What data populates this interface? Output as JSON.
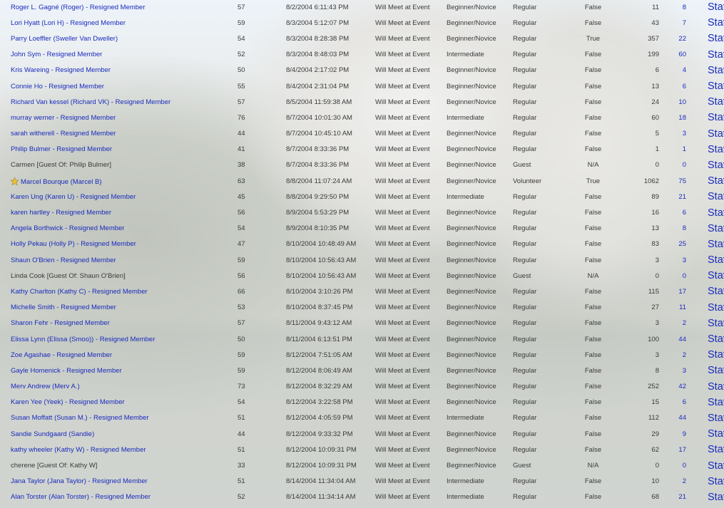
{
  "rows": [
    {
      "name": "Roger L. Gagné (Roger) - Resigned Member",
      "link": true,
      "star": false,
      "age": "57",
      "date": "8/2/2004 6:11:43 PM",
      "meet": "Will Meet at Event",
      "level": "Beginner/Novice",
      "role": "Regular",
      "flag": "False",
      "n1": "11",
      "n2": "8",
      "stats": "Stats"
    },
    {
      "name": "Lori Hyatt (Lori H) - Resigned Member",
      "link": true,
      "star": false,
      "age": "59",
      "date": "8/3/2004 5:12:07 PM",
      "meet": "Will Meet at Event",
      "level": "Beginner/Novice",
      "role": "Regular",
      "flag": "False",
      "n1": "43",
      "n2": "7",
      "stats": "Stats"
    },
    {
      "name": "Parry Loeffler (Sweller Van Dweller)",
      "link": true,
      "star": false,
      "age": "54",
      "date": "8/3/2004 8:28:38 PM",
      "meet": "Will Meet at Event",
      "level": "Beginner/Novice",
      "role": "Regular",
      "flag": "True",
      "n1": "357",
      "n2": "22",
      "stats": "Stats"
    },
    {
      "name": "John Sym - Resigned Member",
      "link": true,
      "star": false,
      "age": "52",
      "date": "8/3/2004 8:48:03 PM",
      "meet": "Will Meet at Event",
      "level": "Intermediate",
      "role": "Regular",
      "flag": "False",
      "n1": "199",
      "n2": "60",
      "stats": "Stats"
    },
    {
      "name": "Kris Wareing - Resigned Member",
      "link": true,
      "star": false,
      "age": "50",
      "date": "8/4/2004 2:17:02 PM",
      "meet": "Will Meet at Event",
      "level": "Beginner/Novice",
      "role": "Regular",
      "flag": "False",
      "n1": "6",
      "n2": "4",
      "stats": "Stats"
    },
    {
      "name": "Connie Ho - Resigned Member",
      "link": true,
      "star": false,
      "age": "55",
      "date": "8/4/2004 2:31:04 PM",
      "meet": "Will Meet at Event",
      "level": "Beginner/Novice",
      "role": "Regular",
      "flag": "False",
      "n1": "13",
      "n2": "6",
      "stats": "Stats"
    },
    {
      "name": "Richard Van kessel (Richard VK) - Resigned Member",
      "link": true,
      "star": false,
      "age": "57",
      "date": "8/5/2004 11:59:38 AM",
      "meet": "Will Meet at Event",
      "level": "Beginner/Novice",
      "role": "Regular",
      "flag": "False",
      "n1": "24",
      "n2": "10",
      "stats": "Stats"
    },
    {
      "name": "murray werner - Resigned Member",
      "link": true,
      "star": false,
      "age": "76",
      "date": "8/7/2004 10:01:30 AM",
      "meet": "Will Meet at Event",
      "level": "Intermediate",
      "role": "Regular",
      "flag": "False",
      "n1": "60",
      "n2": "18",
      "stats": "Stats"
    },
    {
      "name": "sarah witherell - Resigned Member",
      "link": true,
      "star": false,
      "age": "44",
      "date": "8/7/2004 10:45:10 AM",
      "meet": "Will Meet at Event",
      "level": "Beginner/Novice",
      "role": "Regular",
      "flag": "False",
      "n1": "5",
      "n2": "3",
      "stats": "Stats"
    },
    {
      "name": "Philip Bulmer - Resigned Member",
      "link": true,
      "star": false,
      "age": "41",
      "date": "8/7/2004 8:33:36 PM",
      "meet": "Will Meet at Event",
      "level": "Beginner/Novice",
      "role": "Regular",
      "flag": "False",
      "n1": "1",
      "n2": "1",
      "stats": "Stats"
    },
    {
      "name": "Carmen [Guest Of: Philip Bulmer]",
      "link": false,
      "star": false,
      "age": "38",
      "date": "8/7/2004 8:33:36 PM",
      "meet": "Will Meet at Event",
      "level": "Beginner/Novice",
      "role": "Guest",
      "flag": "N/A",
      "n1": "0",
      "n2": "0",
      "stats": "Stats"
    },
    {
      "name": "Marcel Bourque (Marcel B)",
      "link": true,
      "star": true,
      "age": "63",
      "date": "8/8/2004 11:07:24 AM",
      "meet": "Will Meet at Event",
      "level": "Beginner/Novice",
      "role": "Volunteer",
      "flag": "True",
      "n1": "1062",
      "n2": "75",
      "stats": "Stats"
    },
    {
      "name": "Karen Ung (Karen U) - Resigned Member",
      "link": true,
      "star": false,
      "age": "45",
      "date": "8/8/2004 9:29:50 PM",
      "meet": "Will Meet at Event",
      "level": "Intermediate",
      "role": "Regular",
      "flag": "False",
      "n1": "89",
      "n2": "21",
      "stats": "Stats"
    },
    {
      "name": "karen hartley - Resigned Member",
      "link": true,
      "star": false,
      "age": "56",
      "date": "8/9/2004 5:53:29 PM",
      "meet": "Will Meet at Event",
      "level": "Beginner/Novice",
      "role": "Regular",
      "flag": "False",
      "n1": "16",
      "n2": "6",
      "stats": "Stats"
    },
    {
      "name": "Angela Borthwick - Resigned Member",
      "link": true,
      "star": false,
      "age": "54",
      "date": "8/9/2004 8:10:35 PM",
      "meet": "Will Meet at Event",
      "level": "Beginner/Novice",
      "role": "Regular",
      "flag": "False",
      "n1": "13",
      "n2": "8",
      "stats": "Stats"
    },
    {
      "name": "Holly Pekau (Holly P) - Resigned Member",
      "link": true,
      "star": false,
      "age": "47",
      "date": "8/10/2004 10:48:49 AM",
      "meet": "Will Meet at Event",
      "level": "Beginner/Novice",
      "role": "Regular",
      "flag": "False",
      "n1": "83",
      "n2": "25",
      "stats": "Stats"
    },
    {
      "name": "Shaun O'Brien - Resigned Member",
      "link": true,
      "star": false,
      "age": "59",
      "date": "8/10/2004 10:56:43 AM",
      "meet": "Will Meet at Event",
      "level": "Beginner/Novice",
      "role": "Regular",
      "flag": "False",
      "n1": "3",
      "n2": "3",
      "stats": "Stats"
    },
    {
      "name": "Linda Cook [Guest Of: Shaun O'Brien]",
      "link": false,
      "star": false,
      "age": "56",
      "date": "8/10/2004 10:56:43 AM",
      "meet": "Will Meet at Event",
      "level": "Beginner/Novice",
      "role": "Guest",
      "flag": "N/A",
      "n1": "0",
      "n2": "0",
      "stats": "Stats"
    },
    {
      "name": "Kathy Charlton (Kathy C) - Resigned Member",
      "link": true,
      "star": false,
      "age": "66",
      "date": "8/10/2004 3:10:26 PM",
      "meet": "Will Meet at Event",
      "level": "Beginner/Novice",
      "role": "Regular",
      "flag": "False",
      "n1": "115",
      "n2": "17",
      "stats": "Stats"
    },
    {
      "name": "Michelle Smith - Resigned Member",
      "link": true,
      "star": false,
      "age": "53",
      "date": "8/10/2004 8:37:45 PM",
      "meet": "Will Meet at Event",
      "level": "Beginner/Novice",
      "role": "Regular",
      "flag": "False",
      "n1": "27",
      "n2": "11",
      "stats": "Stats"
    },
    {
      "name": "Sharon Fehr - Resigned Member",
      "link": true,
      "star": false,
      "age": "57",
      "date": "8/11/2004 9:43:12 AM",
      "meet": "Will Meet at Event",
      "level": "Beginner/Novice",
      "role": "Regular",
      "flag": "False",
      "n1": "3",
      "n2": "2",
      "stats": "Stats"
    },
    {
      "name": "Elissa Lynn (Elissa (Smoo)) - Resigned Member",
      "link": true,
      "star": false,
      "age": "50",
      "date": "8/11/2004 6:13:51 PM",
      "meet": "Will Meet at Event",
      "level": "Beginner/Novice",
      "role": "Regular",
      "flag": "False",
      "n1": "100",
      "n2": "44",
      "stats": "Stats"
    },
    {
      "name": "Zoe Agashae - Resigned Member",
      "link": true,
      "star": false,
      "age": "59",
      "date": "8/12/2004 7:51:05 AM",
      "meet": "Will Meet at Event",
      "level": "Beginner/Novice",
      "role": "Regular",
      "flag": "False",
      "n1": "3",
      "n2": "2",
      "stats": "Stats"
    },
    {
      "name": "Gayle Homenick - Resigned Member",
      "link": true,
      "star": false,
      "age": "59",
      "date": "8/12/2004 8:06:49 AM",
      "meet": "Will Meet at Event",
      "level": "Beginner/Novice",
      "role": "Regular",
      "flag": "False",
      "n1": "8",
      "n2": "3",
      "stats": "Stats"
    },
    {
      "name": "Merv Andrew (Merv A.)",
      "link": true,
      "star": false,
      "age": "73",
      "date": "8/12/2004 8:32:29 AM",
      "meet": "Will Meet at Event",
      "level": "Beginner/Novice",
      "role": "Regular",
      "flag": "False",
      "n1": "252",
      "n2": "42",
      "stats": "Stats"
    },
    {
      "name": "Karen Yee (Yeek) - Resigned Member",
      "link": true,
      "star": false,
      "age": "54",
      "date": "8/12/2004 3:22:58 PM",
      "meet": "Will Meet at Event",
      "level": "Beginner/Novice",
      "role": "Regular",
      "flag": "False",
      "n1": "15",
      "n2": "6",
      "stats": "Stats"
    },
    {
      "name": "Susan Moffatt (Susan M.) - Resigned Member",
      "link": true,
      "star": false,
      "age": "51",
      "date": "8/12/2004 4:05:59 PM",
      "meet": "Will Meet at Event",
      "level": "Intermediate",
      "role": "Regular",
      "flag": "False",
      "n1": "112",
      "n2": "44",
      "stats": "Stats"
    },
    {
      "name": "Sandie Sundgaard (Sandie)",
      "link": true,
      "star": false,
      "age": "44",
      "date": "8/12/2004 9:33:32 PM",
      "meet": "Will Meet at Event",
      "level": "Beginner/Novice",
      "role": "Regular",
      "flag": "False",
      "n1": "29",
      "n2": "9",
      "stats": "Stats"
    },
    {
      "name": "kathy wheeler (Kathy W) - Resigned Member",
      "link": true,
      "star": false,
      "age": "51",
      "date": "8/12/2004 10:09:31 PM",
      "meet": "Will Meet at Event",
      "level": "Beginner/Novice",
      "role": "Regular",
      "flag": "False",
      "n1": "62",
      "n2": "17",
      "stats": "Stats"
    },
    {
      "name": "cherene [Guest Of: Kathy W]",
      "link": false,
      "star": false,
      "age": "33",
      "date": "8/12/2004 10:09:31 PM",
      "meet": "Will Meet at Event",
      "level": "Beginner/Novice",
      "role": "Guest",
      "flag": "N/A",
      "n1": "0",
      "n2": "0",
      "stats": "Stats"
    },
    {
      "name": "Jana Taylor (Jana Taylor) - Resigned Member",
      "link": true,
      "star": false,
      "age": "51",
      "date": "8/14/2004 11:34:04 AM",
      "meet": "Will Meet at Event",
      "level": "Intermediate",
      "role": "Regular",
      "flag": "False",
      "n1": "10",
      "n2": "2",
      "stats": "Stats"
    },
    {
      "name": "Alan Torster (Alan Torster) - Resigned Member",
      "link": true,
      "star": false,
      "age": "52",
      "date": "8/14/2004 11:34:14 AM",
      "meet": "Will Meet at Event",
      "level": "Intermediate",
      "role": "Regular",
      "flag": "False",
      "n1": "68",
      "n2": "21",
      "stats": "Stats"
    }
  ],
  "colors": {
    "link": "#1a2bbd",
    "text": "#3a3a3a",
    "star": "#e8c23a"
  }
}
